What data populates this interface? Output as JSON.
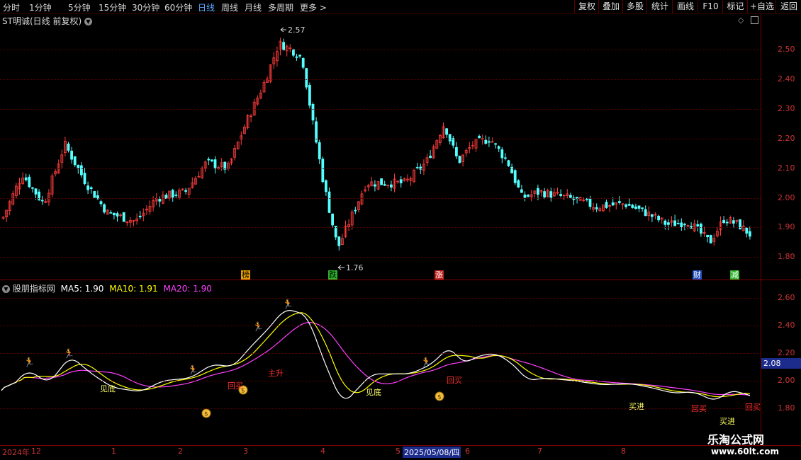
{
  "toolbar": {
    "periods": [
      "分时",
      "1分钟",
      "5分钟",
      "15分钟",
      "30分钟",
      "60分钟",
      "日线",
      "周线",
      "月线",
      "多周期",
      "更多 >"
    ],
    "active_period": "日线",
    "buttons": [
      "复权",
      "叠加",
      "多股",
      "统计",
      "画线",
      "F10",
      "标记",
      "+自选",
      "返回"
    ]
  },
  "main_chart": {
    "title": "ST明诚(日线 前复权)",
    "y_ticks": [
      "2.50",
      "2.40",
      "2.30",
      "2.20",
      "2.10",
      "2.00",
      "1.90",
      "1.80"
    ],
    "high_label": "2.57",
    "low_label": "1.76",
    "tags": [
      {
        "text": "榜",
        "bg": "#e8a000",
        "fg": "#000"
      },
      {
        "text": "跌",
        "bg": "#2db52d",
        "fg": "#000"
      },
      {
        "text": "涨",
        "bg": "#c02020",
        "fg": "#fff"
      },
      {
        "text": "财",
        "bg": "#2050c0",
        "fg": "#fff"
      },
      {
        "text": "减",
        "bg": "#2db52d",
        "fg": "#fff"
      }
    ]
  },
  "indicator": {
    "name": "股朋指标网",
    "ma5_label": "MA5: 1.90",
    "ma10_label": "MA10: 1.91",
    "ma20_label": "MA20: 1.90",
    "y_ticks": [
      "2.60",
      "2.40",
      "2.20",
      "2.00",
      "1.80"
    ],
    "current_value": "2.08",
    "signals": [
      {
        "text": "见底",
        "color": "#ffff66"
      },
      {
        "text": "回买",
        "color": "#ff3030"
      },
      {
        "text": "主升",
        "color": "#ff3030"
      },
      {
        "text": "见底",
        "color": "#ffff66"
      },
      {
        "text": "回买",
        "color": "#ff3030"
      },
      {
        "text": "买进",
        "color": "#ffff66"
      },
      {
        "text": "回买",
        "color": "#ff3030"
      },
      {
        "text": "买进",
        "color": "#ffff66"
      },
      {
        "text": "回买",
        "color": "#ff3030"
      }
    ]
  },
  "date_axis": {
    "labels": [
      "2024年",
      "12",
      "1",
      "2",
      "3",
      "4",
      "5",
      "2025/05/08/四",
      "6",
      "7",
      "8"
    ]
  },
  "watermark": {
    "title": "乐淘公式网",
    "url": "www.60lt.com"
  },
  "colors": {
    "up": "#ff3c3c",
    "down": "#54ffff",
    "ma5": "#ffffff",
    "ma10": "#ffff00",
    "ma20": "#ff40ff"
  }
}
